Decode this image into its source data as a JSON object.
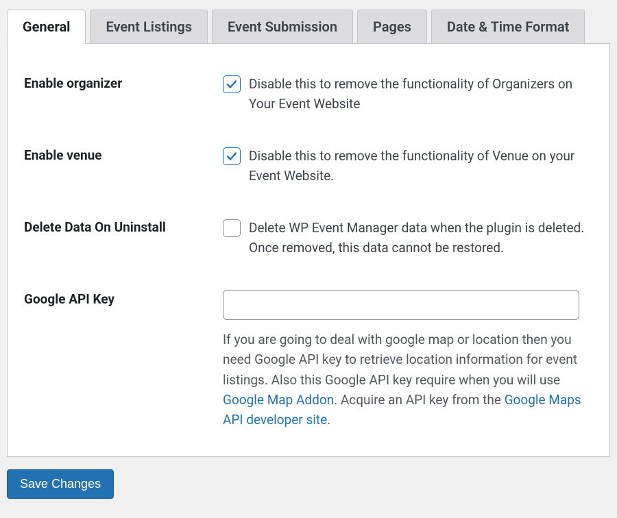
{
  "tabs": {
    "general": {
      "label": "General",
      "active": true
    },
    "listings": {
      "label": "Event Listings",
      "active": false
    },
    "submission": {
      "label": "Event Submission",
      "active": false
    },
    "pages": {
      "label": "Pages",
      "active": false
    },
    "dtformat": {
      "label": "Date & Time Format",
      "active": false
    }
  },
  "settings": {
    "enable_organizer": {
      "label": "Enable organizer",
      "checked": true,
      "text": "Disable this to remove the functionality of Organizers on Your Event Website"
    },
    "enable_venue": {
      "label": "Enable venue",
      "checked": true,
      "text": "Disable this to remove the functionality of Venue on your Event Website."
    },
    "delete_on_uninstall": {
      "label": "Delete Data On Uninstall",
      "checked": false,
      "text": "Delete WP Event Manager data when the plugin is deleted. Once removed, this data cannot be restored."
    },
    "google_api": {
      "label": "Google API Key",
      "value": "",
      "desc_pre": "If you are going to deal with google map or location then you need Google API key to retrieve location information for event listings. Also this Google API key require when you will use ",
      "link1": "Google Map Addon",
      "desc_mid": ". Acquire an API key from the ",
      "link2": "Google Maps API developer site",
      "desc_post": "."
    }
  },
  "actions": {
    "save": "Save Changes"
  }
}
